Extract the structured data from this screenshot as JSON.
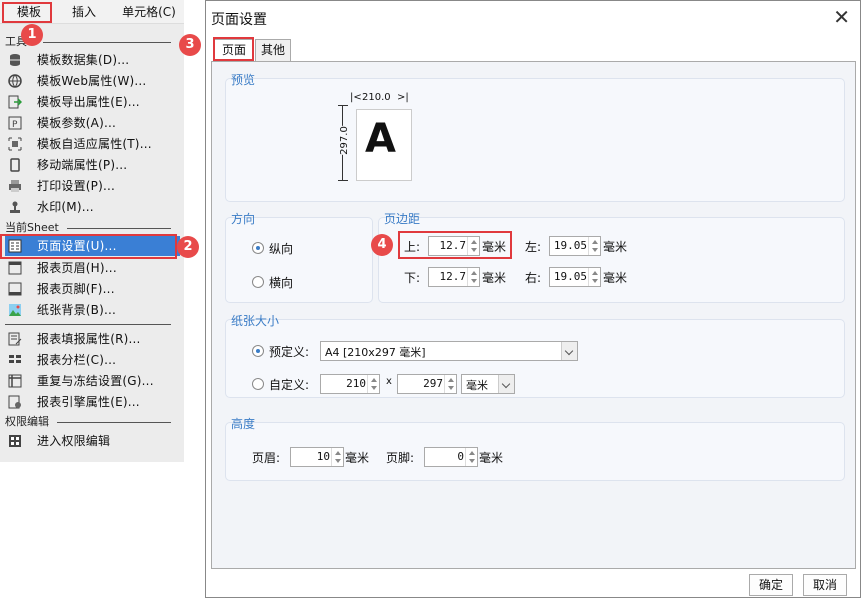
{
  "menu": {
    "tabs": [
      "模板",
      "插入",
      "单元格(C)"
    ],
    "sections": {
      "tools": "工具",
      "current_sheet": "当前Sheet",
      "permission": "权限编辑"
    },
    "items": [
      {
        "label": "模板数据集(D)...",
        "icon": "database-icon"
      },
      {
        "label": "模板Web属性(W)...",
        "icon": "globe-icon"
      },
      {
        "label": "模板导出属性(E)...",
        "icon": "export-icon"
      },
      {
        "label": "模板参数(A)...",
        "icon": "parameter-icon"
      },
      {
        "label": "模板自适应属性(T)...",
        "icon": "adaptive-icon"
      },
      {
        "label": "移动端属性(P)...",
        "icon": "mobile-icon"
      },
      {
        "label": "打印设置(P)...",
        "icon": "printer-icon"
      },
      {
        "label": "水印(M)...",
        "icon": "watermark-icon"
      },
      {
        "label": "页面设置(U)...",
        "icon": "page-setup-icon"
      },
      {
        "label": "报表页眉(H)...",
        "icon": "header-icon"
      },
      {
        "label": "报表页脚(F)...",
        "icon": "footer-icon"
      },
      {
        "label": "纸张背景(B)...",
        "icon": "background-image-icon"
      },
      {
        "label": "报表填报属性(R)...",
        "icon": "fill-report-icon"
      },
      {
        "label": "报表分栏(C)...",
        "icon": "columns-icon"
      },
      {
        "label": "重复与冻结设置(G)...",
        "icon": "freeze-icon"
      },
      {
        "label": "报表引擎属性(E)...",
        "icon": "engine-icon"
      },
      {
        "label": "进入权限编辑",
        "icon": "permission-icon"
      }
    ]
  },
  "badges": [
    "1",
    "2",
    "3",
    "4"
  ],
  "dialog": {
    "title": "页面设置",
    "close": "✕",
    "tabs": [
      "页面",
      "其他"
    ],
    "preview": {
      "title": "预览",
      "width": "210.0",
      "height": "297.0",
      "letter": "A"
    },
    "orientation": {
      "title": "方向",
      "portrait": "纵向",
      "landscape": "横向",
      "selected": "portrait"
    },
    "margin": {
      "title": "页边距",
      "top_label": "上:",
      "top": "12.7",
      "bottom_label": "下:",
      "bottom": "12.7",
      "left_label": "左:",
      "left": "19.05",
      "right_label": "右:",
      "right": "19.05",
      "unit": "毫米"
    },
    "paper": {
      "title": "纸张大小",
      "preset_label": "预定义:",
      "preset_value": "A4 [210x297 毫米]",
      "custom_label": "自定义:",
      "custom_w": "210",
      "x": "x",
      "custom_h": "297",
      "custom_unit": "毫米"
    },
    "height": {
      "title": "高度",
      "header_label": "页眉:",
      "header": "10",
      "footer_label": "页脚:",
      "footer": "0",
      "unit": "毫米"
    },
    "ok": "确定",
    "cancel": "取消"
  }
}
